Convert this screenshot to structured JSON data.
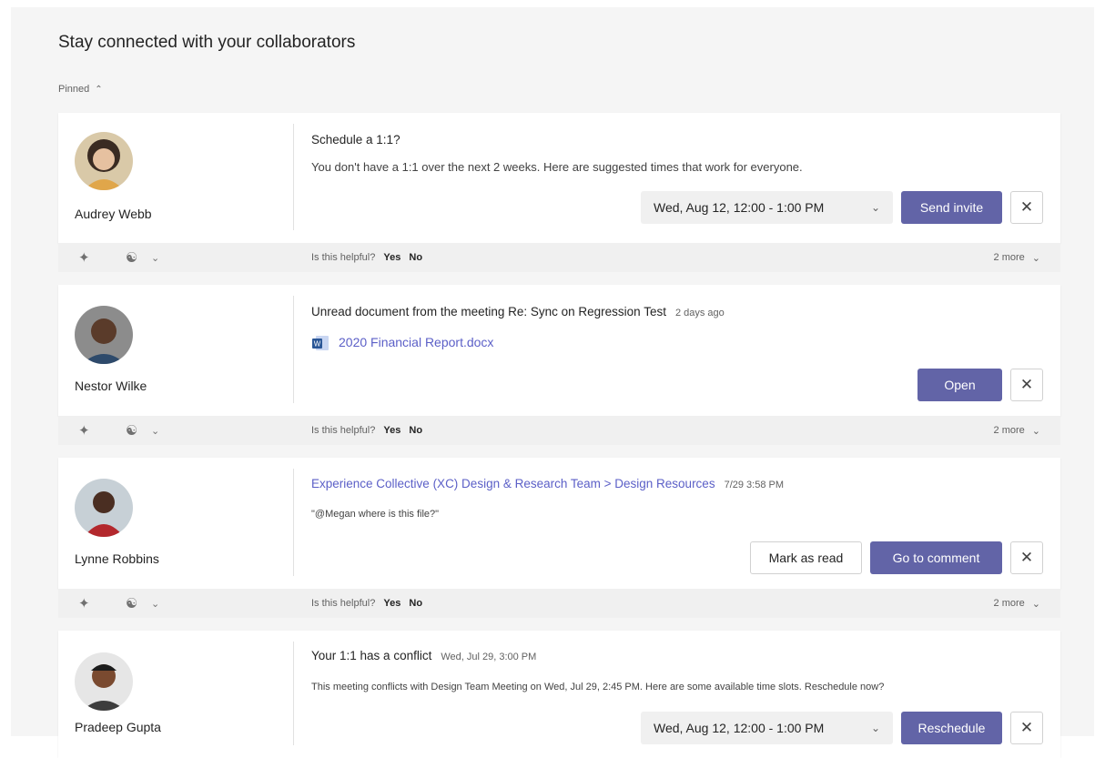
{
  "header": {
    "title": "Stay connected with your collaborators",
    "pinned_label": "Pinned"
  },
  "feedback": {
    "question": "Is this helpful?",
    "yes": "Yes",
    "no": "No",
    "more": "2 more"
  },
  "cards": [
    {
      "person": "Audrey Webb",
      "title": "Schedule a 1:1?",
      "description": "You don't have a 1:1 over the next 2 weeks. Here are suggested times that work for everyone.",
      "time_option": "Wed, Aug 12, 12:00 - 1:00 PM",
      "action": "Send invite"
    },
    {
      "person": "Nestor Wilke",
      "title": "Unread document from the meeting Re: Sync on Regression Test",
      "timestamp": "2 days ago",
      "document": "2020 Financial Report.docx",
      "action": "Open"
    },
    {
      "person": "Lynne Robbins",
      "title": "Experience Collective (XC) Design & Research Team > Design Resources",
      "timestamp": "7/29 3:58 PM",
      "description": "\"@Megan where is this file?\"",
      "secondary_action": "Mark as read",
      "action": "Go to comment"
    },
    {
      "person": "Pradeep Gupta",
      "title": "Your 1:1 has a conflict",
      "timestamp": "Wed, Jul 29, 3:00 PM",
      "description": "This meeting conflicts with Design Team Meeting on Wed, Jul 29, 2:45 PM. Here are some available time slots. Reschedule now?",
      "time_option": "Wed, Aug 12, 12:00 - 1:00 PM",
      "action": "Reschedule"
    }
  ],
  "colors": {
    "accent": "#6264a7",
    "link": "#5b5fc7",
    "page_bg": "#f5f5f5"
  },
  "icons": [
    "chevron-up-icon",
    "unpin-icon",
    "people-icon",
    "chevron-down-icon",
    "close-icon",
    "word-doc-icon"
  ]
}
